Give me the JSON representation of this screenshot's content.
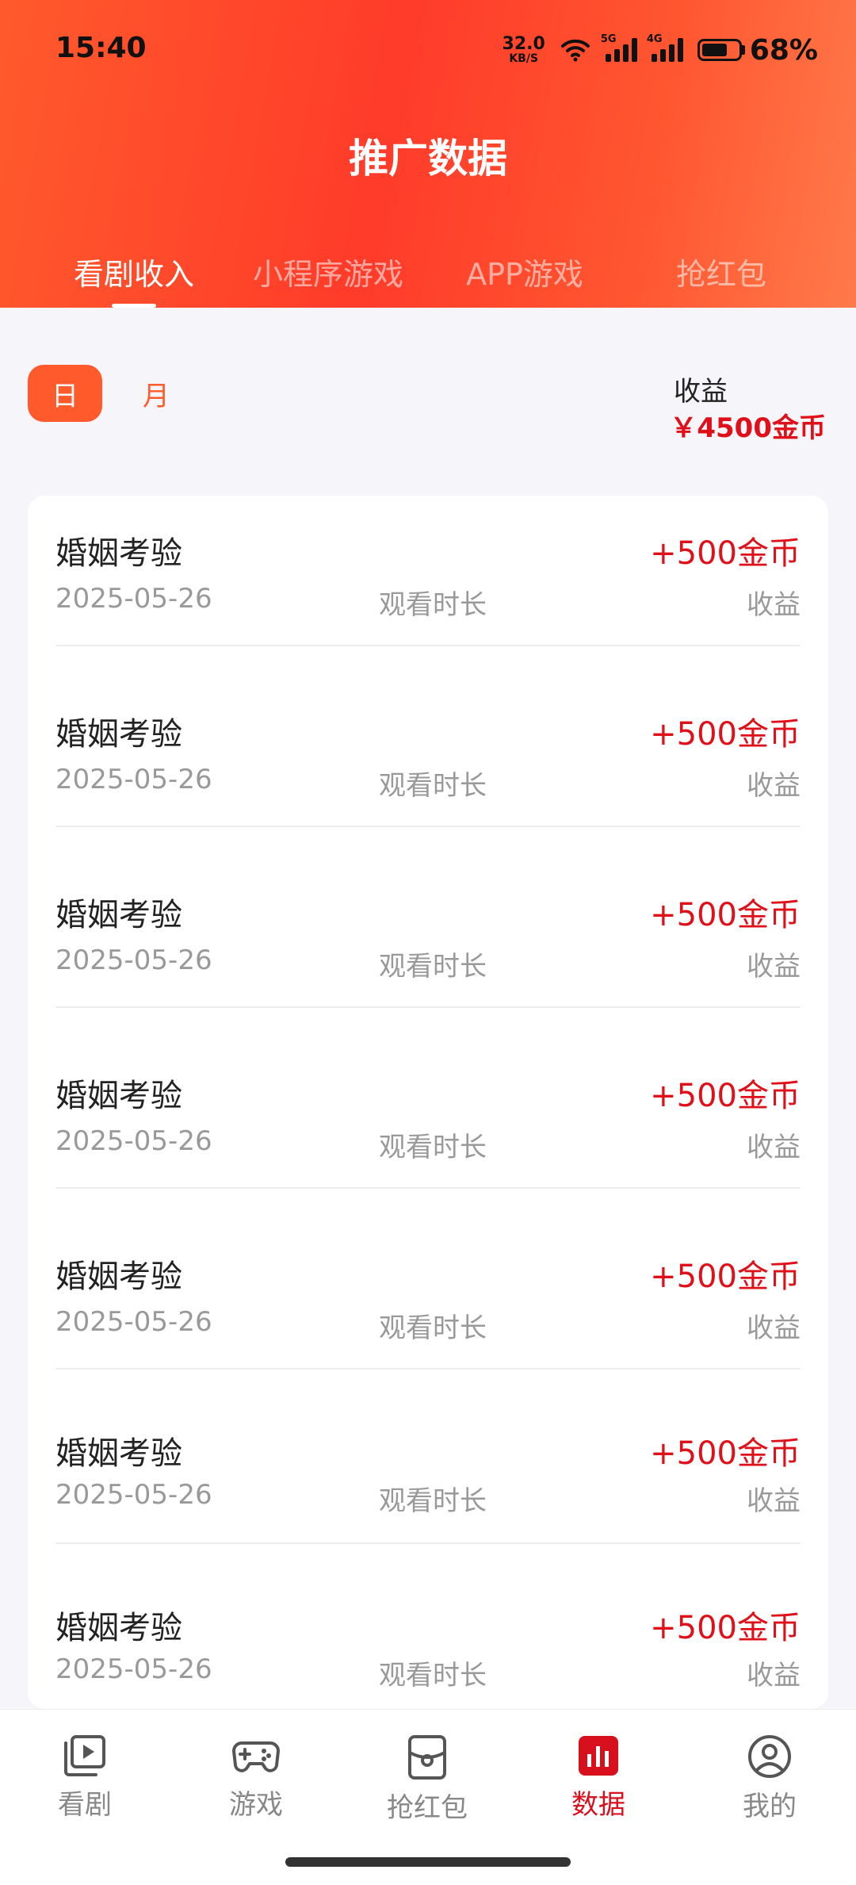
{
  "status_bar": {
    "time": "15:40",
    "net_speed_value": "32.0",
    "net_speed_unit": "KB/S",
    "signal1_tag": "5G",
    "signal2_tag": "4G",
    "battery_percent": "68%"
  },
  "header": {
    "title": "推广数据",
    "tabs": [
      {
        "label": "看剧收入",
        "active": true
      },
      {
        "label": "小程序游戏",
        "active": false
      },
      {
        "label": "APP游戏",
        "active": false
      },
      {
        "label": "抢红包",
        "active": false
      }
    ]
  },
  "filter": {
    "day_label": "日",
    "month_label": "月",
    "earnings_label": "收益",
    "earnings_value": "￥4500金币"
  },
  "records": [
    {
      "name": "婚姻考验",
      "amount": "+500金币",
      "date": "2025-05-26",
      "mid_label": "观看时长",
      "right_label": "收益"
    },
    {
      "name": "婚姻考验",
      "amount": "+500金币",
      "date": "2025-05-26",
      "mid_label": "观看时长",
      "right_label": "收益"
    },
    {
      "name": "婚姻考验",
      "amount": "+500金币",
      "date": "2025-05-26",
      "mid_label": "观看时长",
      "right_label": "收益"
    },
    {
      "name": "婚姻考验",
      "amount": "+500金币",
      "date": "2025-05-26",
      "mid_label": "观看时长",
      "right_label": "收益"
    },
    {
      "name": "婚姻考验",
      "amount": "+500金币",
      "date": "2025-05-26",
      "mid_label": "观看时长",
      "right_label": "收益"
    },
    {
      "name": "婚姻考验",
      "amount": "+500金币",
      "date": "2025-05-26",
      "mid_label": "观看时长",
      "right_label": "收益"
    },
    {
      "name": "婚姻考验",
      "amount": "+500金币",
      "date": "2025-05-26",
      "mid_label": "观看时长",
      "right_label": "收益"
    }
  ],
  "tabbar": [
    {
      "label": "看剧",
      "icon": "play-card-icon",
      "active": false
    },
    {
      "label": "游戏",
      "icon": "gamepad-icon",
      "active": false
    },
    {
      "label": "抢红包",
      "icon": "red-packet-icon",
      "active": false
    },
    {
      "label": "数据",
      "icon": "bar-chart-icon",
      "active": true
    },
    {
      "label": "我的",
      "icon": "user-icon",
      "active": false
    }
  ],
  "colors": {
    "accent": "#ff5a2c",
    "amount_red": "#e0101a",
    "tab_active": "#d8101e"
  }
}
